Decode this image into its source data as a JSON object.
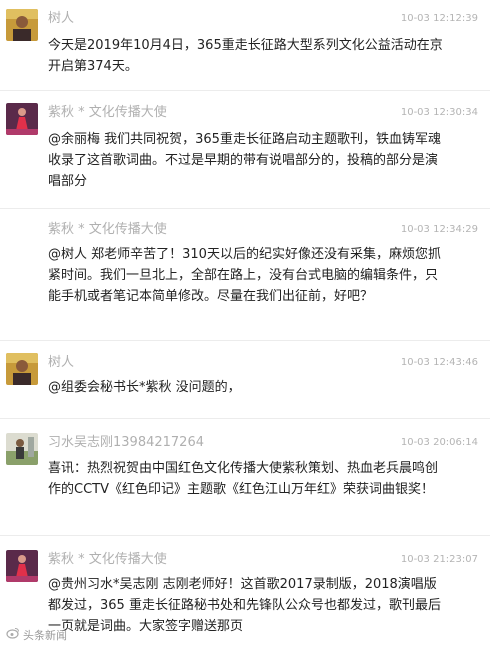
{
  "messages": [
    {
      "user": "树人",
      "time": "10-03 12:12:39",
      "text": "今天是2019年10月4日，365重走长征路大型系列文化公益活动在京开启第374天。",
      "avatar": "avatar-man-yellow"
    },
    {
      "user": "紫秋 * 文化传播大使",
      "time": "10-03 12:30:34",
      "text": "@余丽梅 我们共同祝贺，365重走长征路启动主题歌刊，铁血铸军魂收录了这首歌词曲。不过是早期的带有说唱部分的，投稿的部分是演唱部分",
      "avatar": "avatar-woman-red"
    },
    {
      "user": "紫秋 * 文化传播大使",
      "time": "10-03 12:34:29",
      "text": "@树人 郑老师辛苦了！310天以后的纪实好像还没有采集，麻烦您抓紧时间。我们一旦北上，全部在路上，没有台式电脑的编辑条件，只能手机或者笔记本简单修改。尽量在我们出征前，好吧？",
      "avatar": ""
    },
    {
      "user": "树人",
      "time": "10-03 12:43:46",
      "text": "@组委会秘书长*紫秋 没问题的，",
      "avatar": "avatar-man-yellow"
    },
    {
      "user": "习水吴志刚13984217264",
      "time": "10-03 20:06:14",
      "text": "喜讯：热烈祝贺由中国红色文化传播大使紫秋策划、热血老兵晨鸣创作的CCTV《红色印记》主题歌《红色江山万年红》荣获词曲银奖！",
      "avatar": "avatar-man-outdoor"
    },
    {
      "user": "紫秋 * 文化传播大使",
      "time": "10-03 21:23:07",
      "text": "@贵州习水*吴志刚 志刚老师好！这首歌2017录制版，2018演唱版都发过，365 重走长征路秘书处和先锋队公众号也都发过，歌刊最后一页就是词曲。大家签字赠送那页",
      "avatar": "avatar-woman-red"
    }
  ],
  "watermark": "头条新闻"
}
